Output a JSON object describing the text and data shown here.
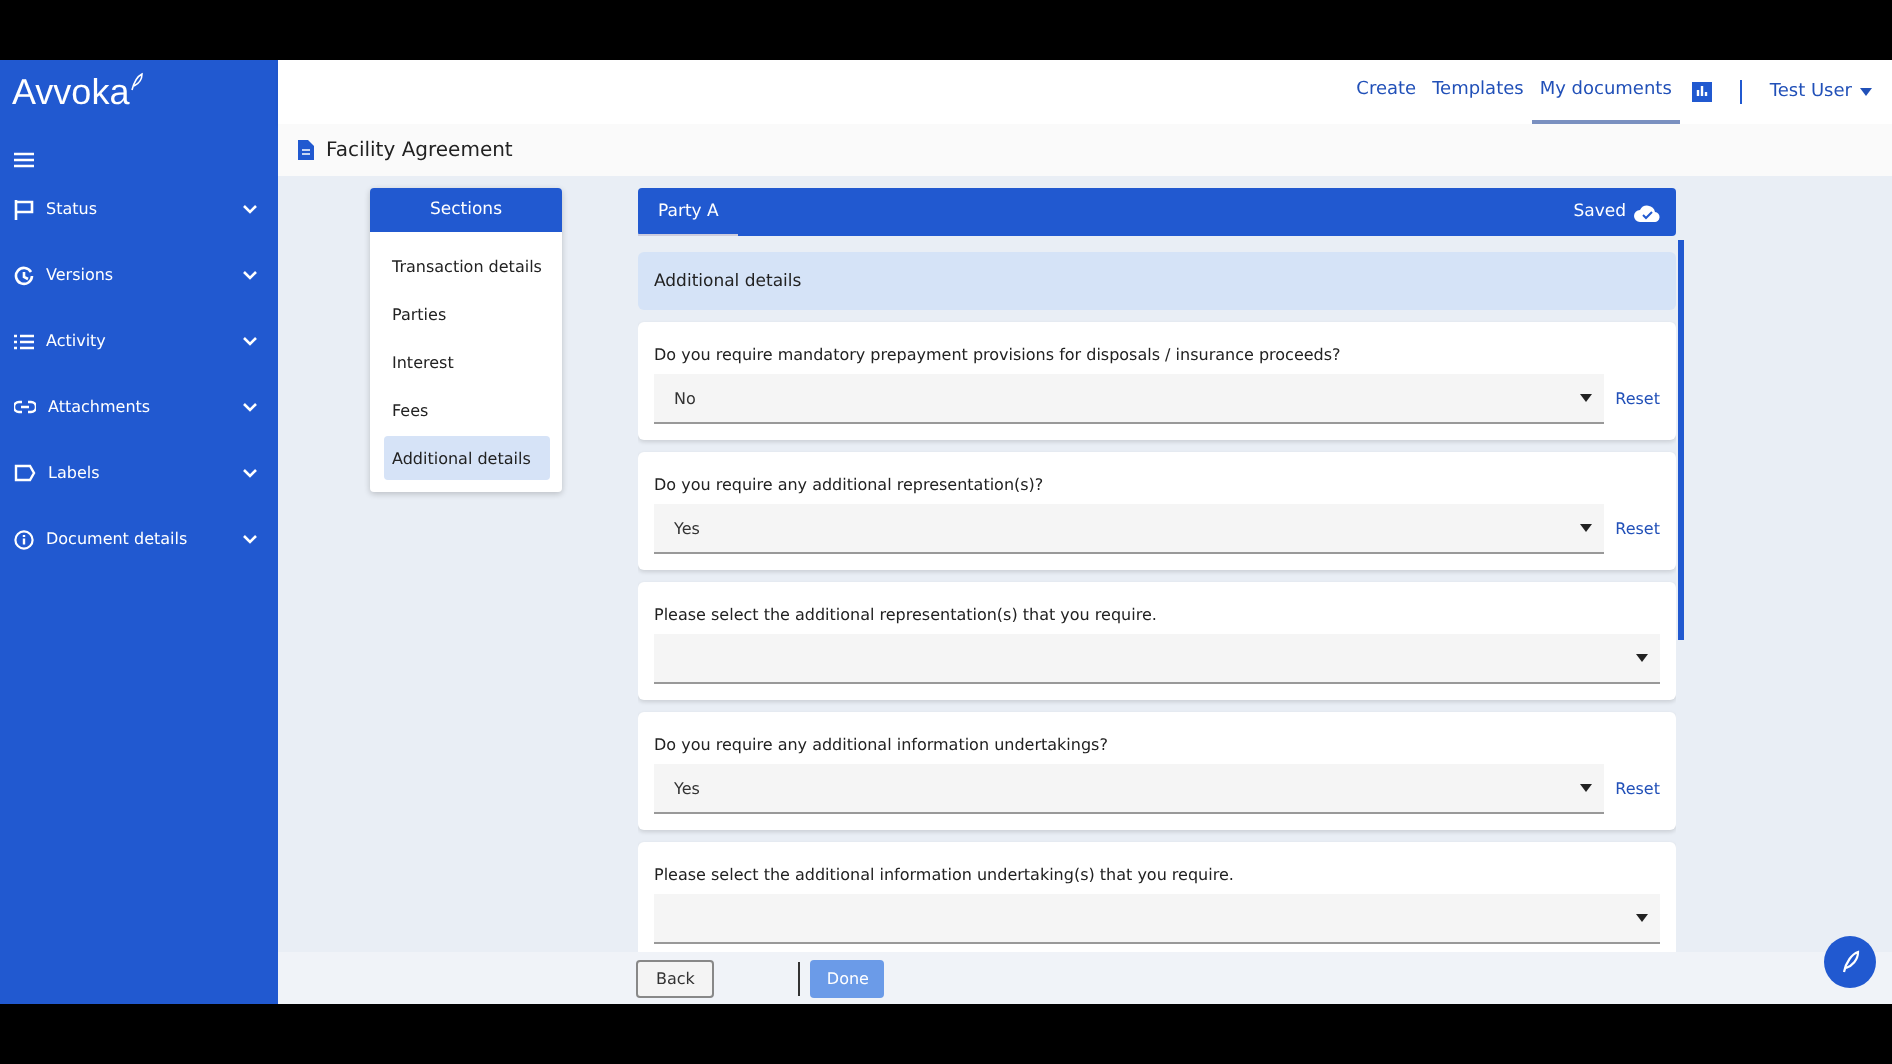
{
  "sidebar": {
    "logo": "Avvoka",
    "items": [
      {
        "label": "Status"
      },
      {
        "label": "Versions"
      },
      {
        "label": "Activity"
      },
      {
        "label": "Attachments"
      },
      {
        "label": "Labels"
      },
      {
        "label": "Document details"
      }
    ]
  },
  "nav": [
    {
      "label": "Create",
      "selected": false
    },
    {
      "label": "Templates",
      "selected": false
    },
    {
      "label": "My documents",
      "selected": true
    }
  ],
  "user": "Test User",
  "document": {
    "title": "Facility Agreement"
  },
  "sections": {
    "title": "Sections",
    "items": [
      {
        "label": "Transaction details",
        "selected": false
      },
      {
        "label": "Parties",
        "selected": false
      },
      {
        "label": "Interest",
        "selected": false
      },
      {
        "label": "Fees",
        "selected": false
      },
      {
        "label": "Additional details",
        "selected": true
      }
    ]
  },
  "form": {
    "tab": "Party A",
    "status": "Saved",
    "heading": "Additional details",
    "questions": [
      {
        "label": "Do you require mandatory prepayment provisions for disposals / insurance proceeds?",
        "value": "No",
        "reset": "Reset"
      },
      {
        "label": "Do you require any additional representation(s)?",
        "value": "Yes",
        "reset": "Reset"
      },
      {
        "label": "Please select the additional representation(s) that you require."
      },
      {
        "label": "Do you require any additional information undertakings?",
        "value": "Yes",
        "reset": "Reset"
      },
      {
        "label": "Please select the additional information undertaking(s) that you require."
      }
    ]
  },
  "footer": {
    "back": "Back",
    "done": "Done"
  }
}
